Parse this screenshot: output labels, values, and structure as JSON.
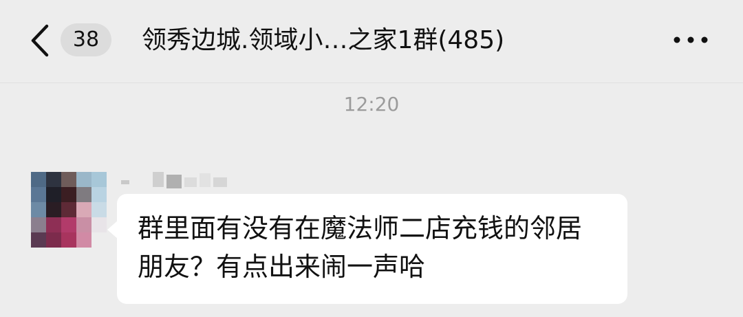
{
  "header": {
    "unread_count": "38",
    "title": "领秀边城.领域小…之家1群(485)",
    "back_icon": "chevron-left-icon",
    "more_icon": "more-dots-icon"
  },
  "messages": [
    {
      "time": "12:20",
      "text": "群里面有没有在魔法师二店充钱的邻居朋友？有点出来闹一声哈"
    }
  ],
  "colors": {
    "background": "#ededed",
    "bubble": "#ffffff",
    "badge": "#dcdcdc",
    "timestamp": "#9b9b9b"
  }
}
